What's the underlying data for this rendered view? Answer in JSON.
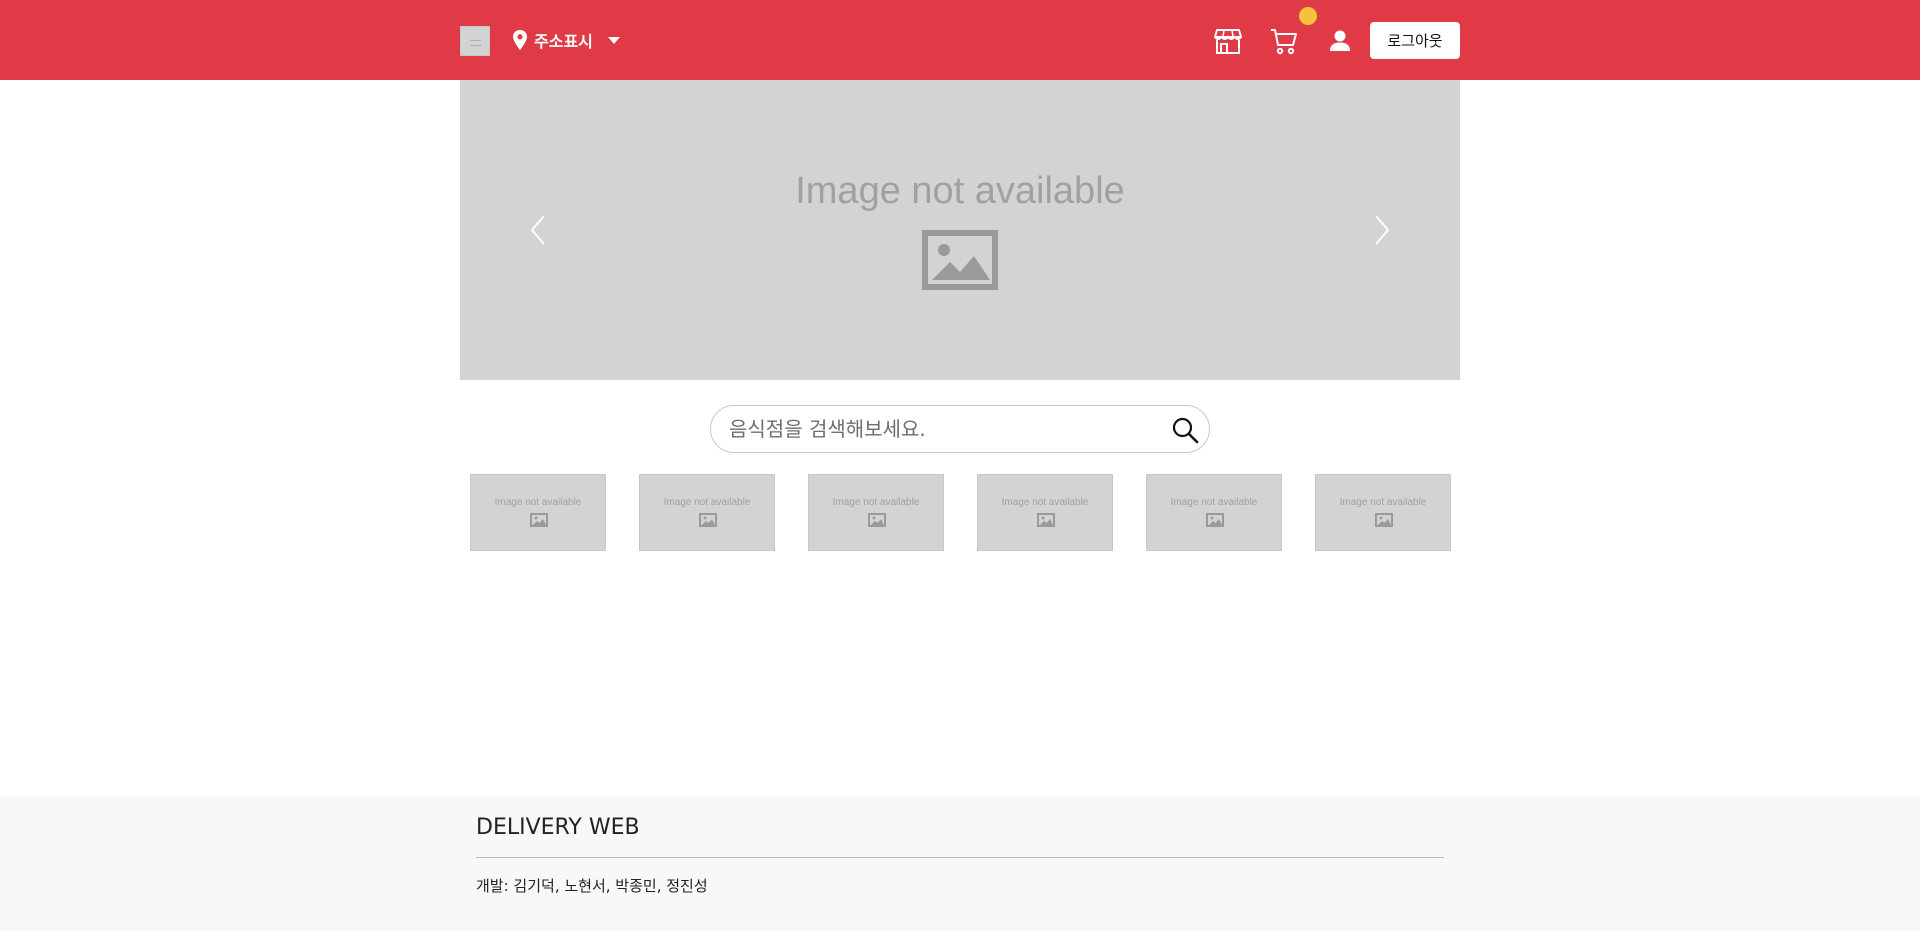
{
  "header": {
    "address_label": "주소표시",
    "icons": [
      "store-icon",
      "cart-icon",
      "user-icon"
    ],
    "logout_label": "로그아웃",
    "colors": {
      "bar": "#e03a47",
      "badge": "#f7c23a"
    }
  },
  "banner": {
    "placeholder_text": "Image not available"
  },
  "search": {
    "placeholder": "음식점을 검색해보세요."
  },
  "categories": [
    {
      "text": "Image not available"
    },
    {
      "text": "Image not available"
    },
    {
      "text": "Image not available"
    },
    {
      "text": "Image not available"
    },
    {
      "text": "Image not available"
    },
    {
      "text": "Image not available"
    }
  ],
  "footer": {
    "brand": "DELIVERY WEB",
    "developers": "개발: 김기덕, 노현서, 박종민, 정진성"
  }
}
